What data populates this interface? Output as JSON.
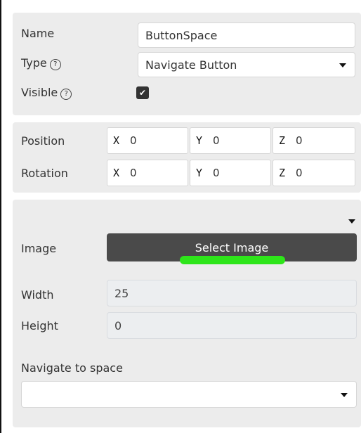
{
  "basic": {
    "name_label": "Name",
    "name_value": "ButtonSpace",
    "type_label": "Type",
    "type_help": "?",
    "type_value": "Navigate Button",
    "visible_label": "Visible",
    "visible_help": "?",
    "visible_checked": true,
    "check_glyph": "✔"
  },
  "transform": {
    "position_label": "Position",
    "rotation_label": "Rotation",
    "position": [
      {
        "axis": "X",
        "value": "0"
      },
      {
        "axis": "Y",
        "value": "0"
      },
      {
        "axis": "Z",
        "value": "0"
      }
    ],
    "rotation": [
      {
        "axis": "X",
        "value": "0"
      },
      {
        "axis": "Y",
        "value": "0"
      },
      {
        "axis": "Z",
        "value": "0"
      }
    ]
  },
  "appearance": {
    "image_label": "Image",
    "select_image_label": "Select Image",
    "width_label": "Width",
    "width_value": "25",
    "height_label": "Height",
    "height_value": "0",
    "navigate_label": "Navigate to space",
    "navigate_value": ""
  },
  "colors": {
    "panel_bg": "#ececec",
    "button_bg": "#4a4a4a",
    "highlight": "#2ee51a"
  }
}
